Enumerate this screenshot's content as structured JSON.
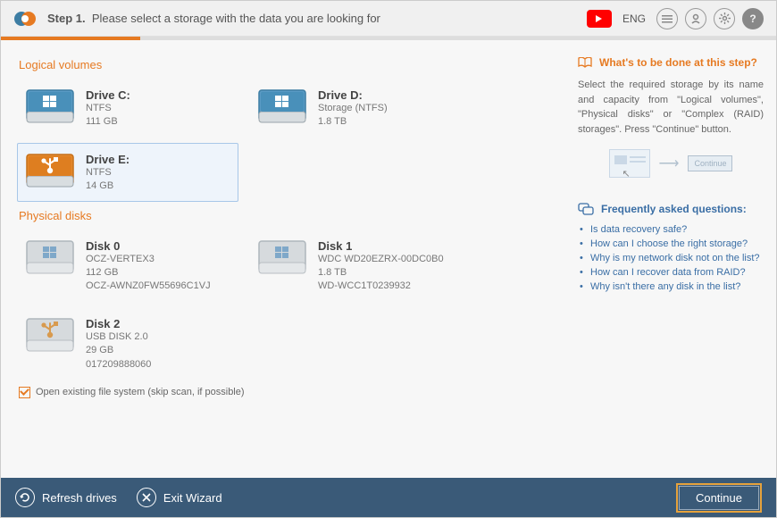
{
  "header": {
    "step_label": "Step 1.",
    "step_desc": "Please select a storage with the data you are looking for",
    "lang": "ENG"
  },
  "sections": {
    "logical": "Logical volumes",
    "physical": "Physical disks"
  },
  "logical": [
    {
      "name": "Drive C:",
      "fs": "NTFS",
      "size": "111 GB",
      "type": "win",
      "selected": false
    },
    {
      "name": "Drive D:",
      "fs": "Storage (NTFS)",
      "size": "1.8 TB",
      "type": "win",
      "selected": false
    },
    {
      "name": "Drive E:",
      "fs": "NTFS",
      "size": "14 GB",
      "type": "usb",
      "selected": true
    }
  ],
  "physical": [
    {
      "name": "Disk 0",
      "l1": "OCZ-VERTEX3",
      "l2": "112 GB",
      "l3": "OCZ-AWNZ0FW55696C1VJ",
      "type": "win"
    },
    {
      "name": "Disk 1",
      "l1": "WDC WD20EZRX-00DC0B0",
      "l2": "1.8 TB",
      "l3": "WD-WCC1T0239932",
      "type": "win"
    },
    {
      "name": "Disk 2",
      "l1": "USB DISK 2.0",
      "l2": "29 GB",
      "l3": "017209888060",
      "type": "usb"
    }
  ],
  "checkbox": {
    "label": "Open existing file system (skip scan, if possible)"
  },
  "help": {
    "title": "What's to be done at this step?",
    "text": "Select the required storage by its name and capacity from \"Logical volumes\", \"Physical disks\" or \"Complex (RAID) storages\". Press \"Continue\" button.",
    "illus_btn": "Continue"
  },
  "faq": {
    "title": "Frequently asked questions:",
    "items": [
      "Is data recovery safe?",
      "How can I choose the right storage?",
      "Why is my network disk not on the list?",
      "How can I recover data from RAID?",
      "Why isn't there any disk in the list?"
    ]
  },
  "footer": {
    "refresh": "Refresh drives",
    "exit": "Exit Wizard",
    "cont": "Continue"
  }
}
